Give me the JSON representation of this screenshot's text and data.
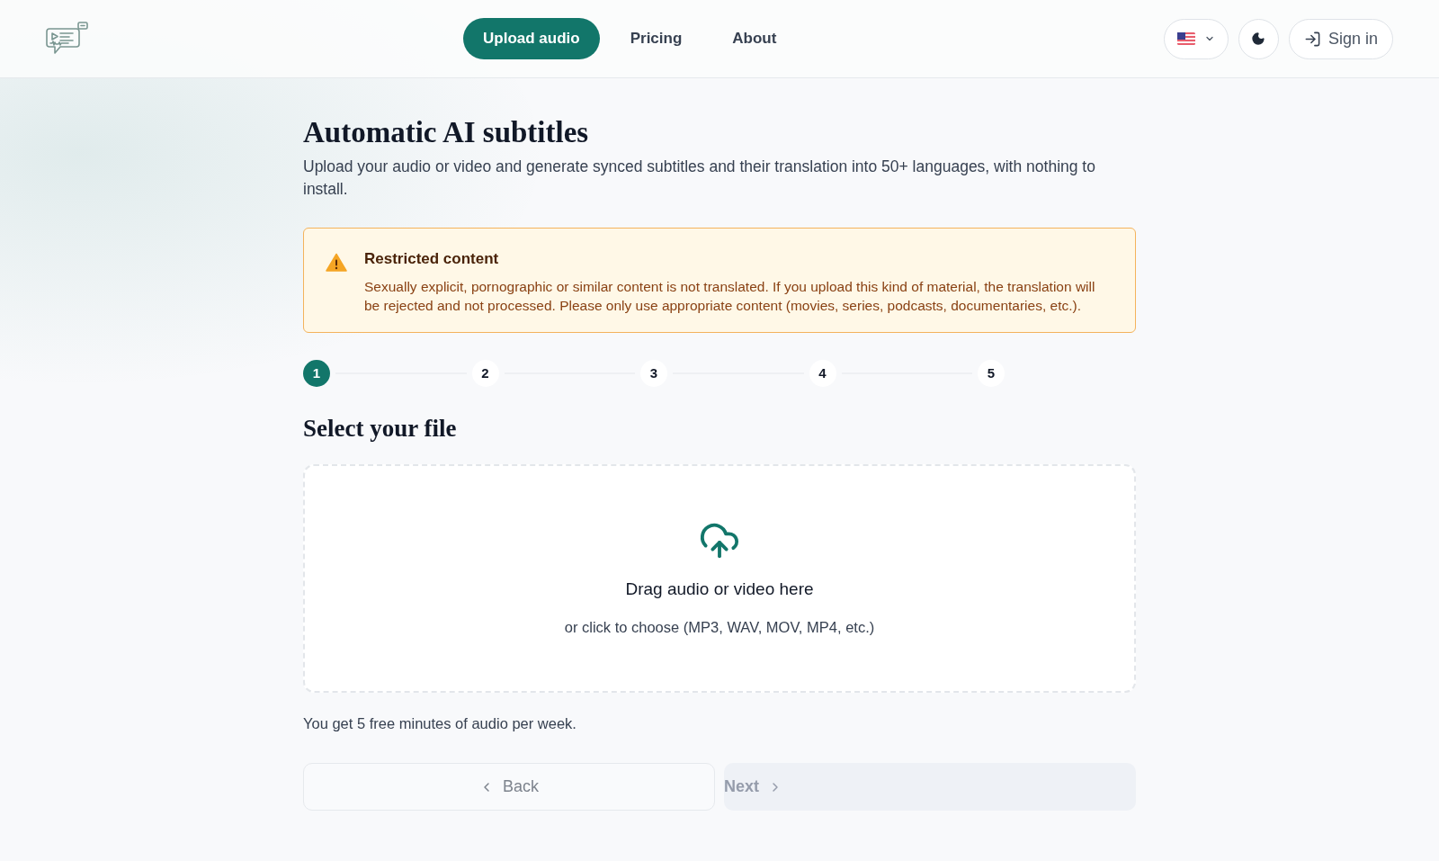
{
  "header": {
    "nav": [
      {
        "label": "Upload audio",
        "selected": true
      },
      {
        "label": "Pricing",
        "selected": false
      },
      {
        "label": "About",
        "selected": false
      }
    ],
    "sign_in": {
      "label": "Sign in"
    }
  },
  "intro": {
    "title": "Automatic AI subtitles",
    "description": "Upload your audio or video and generate synced subtitles and their translation into 50+ languages, with nothing to install."
  },
  "alert": {
    "title": "Restricted content",
    "message": "Sexually explicit, pornographic or similar content is not translated. If you upload this kind of material, the translation will be rejected and not processed. Please only use appropriate content (movies, series, podcasts, documentaries, etc.)."
  },
  "stepper": {
    "steps": [
      {
        "label": "1",
        "selected": true
      },
      {
        "label": "2",
        "selected": false
      },
      {
        "label": "3",
        "selected": false
      },
      {
        "label": "4",
        "selected": false
      },
      {
        "label": "5",
        "selected": false
      }
    ]
  },
  "section_title": "Select your file",
  "dropzone": {
    "title": "Drag audio or video here",
    "hint": "or click to choose (MP3, WAV, MOV, MP4, etc.)"
  },
  "quota_note": "You get 5 free minutes of audio per week.",
  "buttons": [
    {
      "kind": "back",
      "label": "Back",
      "disabled": false
    },
    {
      "kind": "next",
      "label": "Next",
      "disabled": true
    }
  ]
}
